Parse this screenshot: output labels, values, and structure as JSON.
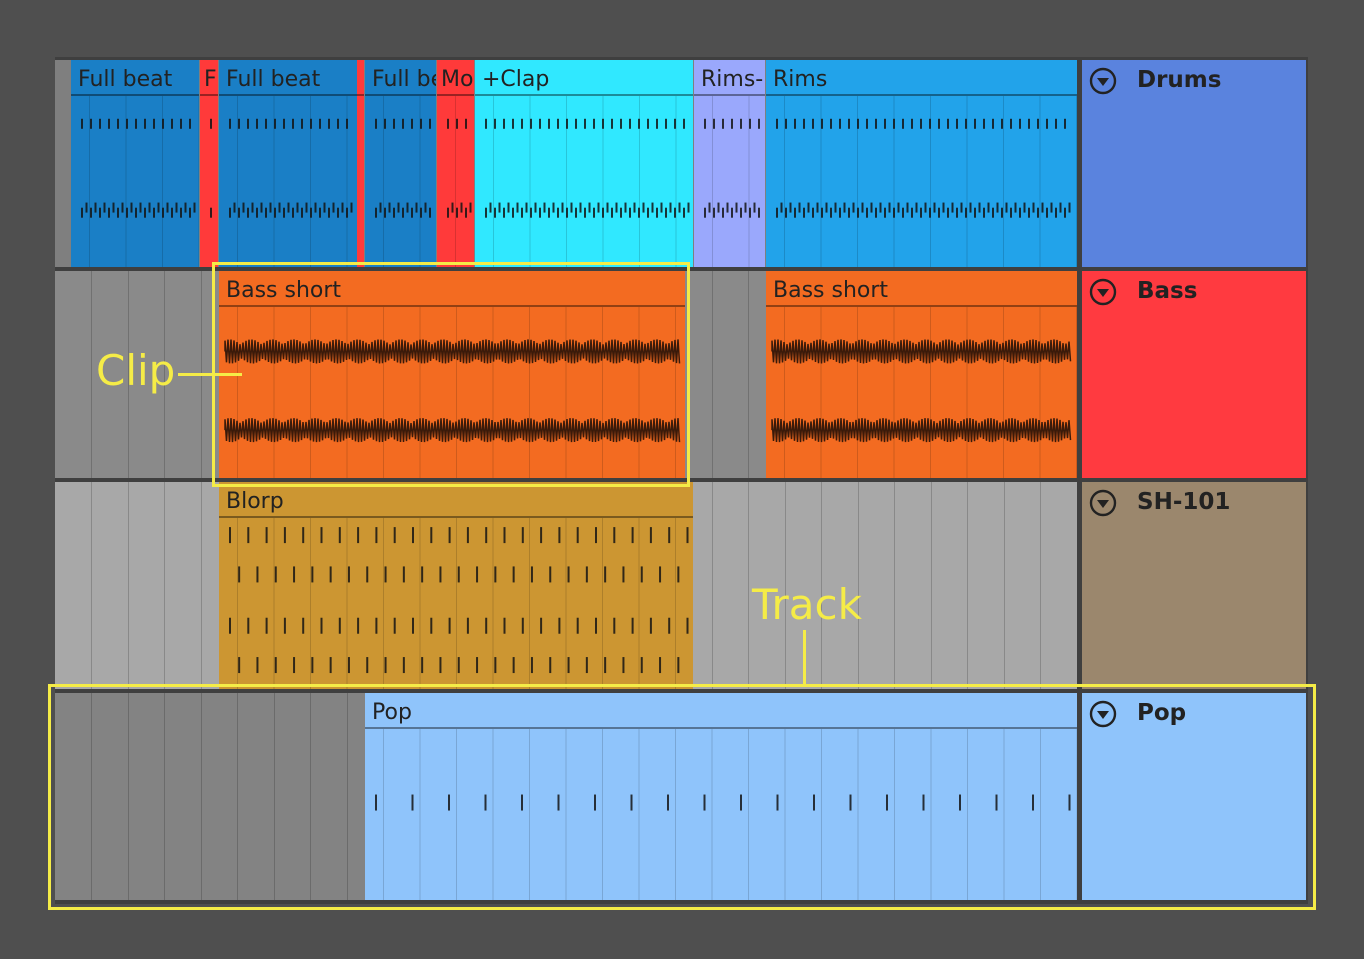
{
  "tracks": [
    {
      "id": "drums",
      "name": "Drums",
      "color": "#5a83de",
      "lane_color": "#7f7f7f",
      "icon": "collapse-arrow-icon",
      "clips": [
        {
          "label": "Full beat",
          "color": "#1a7fc6",
          "type": "midi"
        },
        {
          "label": "F",
          "color": "#ff3a3a",
          "type": "midi"
        },
        {
          "label": "Full beat",
          "color": "#1a7fc6",
          "type": "midi"
        },
        {
          "label": "",
          "color": "#ff3a3a",
          "type": "midi"
        },
        {
          "label": "Full be",
          "color": "#1a7fc6",
          "type": "midi"
        },
        {
          "label": "Mo",
          "color": "#ff3a3a",
          "type": "midi"
        },
        {
          "label": "+Clap",
          "color": "#30e8ff",
          "type": "midi"
        },
        {
          "label": "Rims-",
          "color": "#9aa8fc",
          "type": "midi"
        },
        {
          "label": "Rims",
          "color": "#22a3ea",
          "type": "midi"
        }
      ]
    },
    {
      "id": "bass",
      "name": "Bass",
      "color": "#ff3a40",
      "lane_color": "#8a8a8a",
      "icon": "collapse-arrow-icon",
      "clips": [
        {
          "label": "Bass short",
          "color": "#f36b21",
          "type": "audio"
        },
        {
          "label": "Bass short",
          "color": "#f36b21",
          "type": "audio"
        }
      ]
    },
    {
      "id": "sh101",
      "name": "SH-101",
      "color": "#9b876d",
      "lane_color": "#a8a8a8",
      "icon": "collapse-arrow-icon",
      "clips": [
        {
          "label": "Blorp",
          "color": "#cc9632",
          "type": "midi"
        }
      ]
    },
    {
      "id": "pop",
      "name": "Pop",
      "color": "#8fc4fb",
      "lane_color": "#838383",
      "icon": "collapse-arrow-icon",
      "clips": [
        {
          "label": "Pop",
          "color": "#8fc4fb",
          "type": "midi"
        }
      ]
    }
  ],
  "annotations": {
    "clip_label": "Clip",
    "track_label": "Track",
    "color": "#f5ec47"
  }
}
